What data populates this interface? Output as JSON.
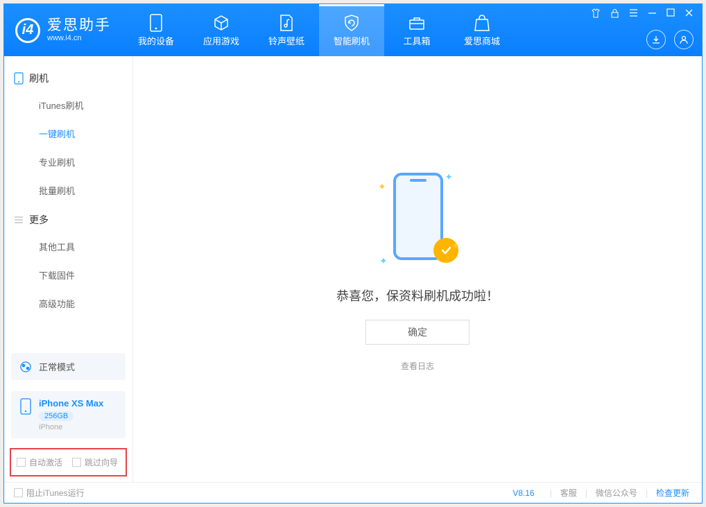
{
  "brand": {
    "title": "爱思助手",
    "subtitle": "www.i4.cn"
  },
  "tabs": [
    {
      "label": "我的设备"
    },
    {
      "label": "应用游戏"
    },
    {
      "label": "铃声壁纸"
    },
    {
      "label": "智能刷机"
    },
    {
      "label": "工具箱"
    },
    {
      "label": "爱思商城"
    }
  ],
  "sidebar": {
    "section1": "刷机",
    "items1": [
      "iTunes刷机",
      "一键刷机",
      "专业刷机",
      "批量刷机"
    ],
    "section2": "更多",
    "items2": [
      "其他工具",
      "下载固件",
      "高级功能"
    ]
  },
  "mode": {
    "label": "正常模式"
  },
  "device": {
    "name": "iPhone XS Max",
    "capacity": "256GB",
    "type": "iPhone"
  },
  "options": {
    "auto_activate": "自动激活",
    "skip_guide": "跳过向导"
  },
  "main": {
    "success_text": "恭喜您，保资料刷机成功啦！",
    "ok_label": "确定",
    "log_link": "查看日志"
  },
  "footer": {
    "block_itunes": "阻止iTunes运行",
    "version": "V8.16",
    "links": [
      "客服",
      "微信公众号",
      "检查更新"
    ]
  }
}
